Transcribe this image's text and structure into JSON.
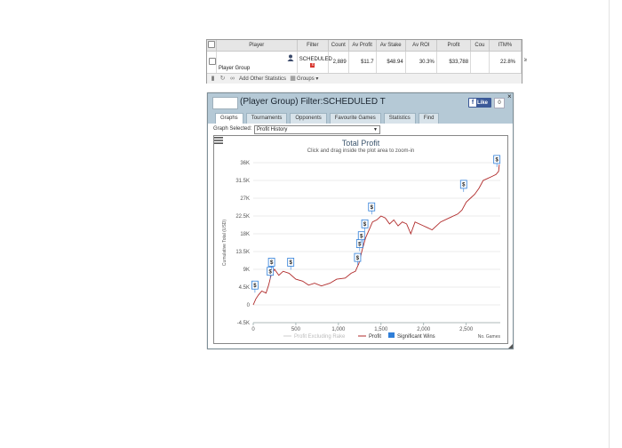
{
  "stats_table": {
    "headers": [
      "",
      "Player",
      "Filter",
      "Count",
      "Av Profit",
      "Av Stake",
      "Av ROI",
      "Profit",
      "Cou",
      "ITM%"
    ],
    "row": {
      "player": "Player Group",
      "filter": "SCHEDULED",
      "filter_badge": "x",
      "count": "2,889",
      "av_profit": "$11.7",
      "av_stake": "$48.94",
      "av_roi": "30.3%",
      "profit": "$33,788",
      "cou": "",
      "itm": "22.8%",
      "overflow": "≥"
    },
    "footer": {
      "add_stats": "Add Other Statistics",
      "groups": "Groups ▾"
    }
  },
  "window": {
    "title": "(Player Group) Filter:SCHEDULED T",
    "fb_like": "Like",
    "fb_count": "0",
    "close": "×",
    "tabs": [
      "Graphs",
      "Tournaments",
      "Opponents",
      "Favourite Games",
      "Statistics",
      "Find"
    ],
    "active_tab": "Graphs",
    "graph_selected_label": "Graph Selected:",
    "graph_selected_value": "Profit History"
  },
  "chart_data": {
    "type": "line",
    "title": "Total Profit",
    "subtitle": "Click and drag inside the plot area to zoom-in",
    "xlabel": "No. Games",
    "ylabel": "Cumulative Total (USD)",
    "xlim": [
      0,
      2900
    ],
    "ylim": [
      -4500,
      36000
    ],
    "x_ticks": [
      "0",
      "500",
      "1,000",
      "1,500",
      "2,000",
      "2,500"
    ],
    "y_ticks": [
      "-4.5K",
      "0",
      "4.5K",
      "9K",
      "13.5K",
      "18K",
      "22.5K",
      "27K",
      "31.5K",
      "36K"
    ],
    "legend": [
      {
        "name": "Profit Excluding Rake",
        "color": "#cccccc"
      },
      {
        "name": "Profit",
        "color": "#b02a2a"
      },
      {
        "name": "Significant Wins",
        "color": "#2f7ed8"
      }
    ],
    "series": [
      {
        "name": "Profit",
        "color": "#b02a2a",
        "x": [
          0,
          30,
          60,
          100,
          150,
          180,
          210,
          250,
          300,
          350,
          420,
          500,
          580,
          650,
          720,
          800,
          900,
          980,
          1080,
          1150,
          1200,
          1240,
          1280,
          1320,
          1360,
          1400,
          1450,
          1500,
          1550,
          1600,
          1650,
          1700,
          1750,
          1800,
          1850,
          1900,
          2000,
          2050,
          2100,
          2200,
          2300,
          2400,
          2450,
          2500,
          2550,
          2600,
          2650,
          2700,
          2750,
          2800,
          2850,
          2880,
          2889
        ],
        "y": [
          0,
          1500,
          2500,
          3500,
          3000,
          5000,
          7500,
          9000,
          7500,
          8500,
          8000,
          6500,
          6000,
          5000,
          5500,
          4800,
          5500,
          6500,
          6800,
          8000,
          8500,
          10500,
          14000,
          17000,
          19000,
          21000,
          21500,
          22500,
          22000,
          20500,
          21500,
          20000,
          21000,
          20500,
          18000,
          21000,
          20000,
          19500,
          19000,
          21000,
          22000,
          23000,
          24000,
          26000,
          27000,
          28000,
          29500,
          31500,
          32000,
          32500,
          33000,
          33788,
          35500
        ]
      }
    ],
    "significant_wins": [
      {
        "x": 20,
        "y": 4000
      },
      {
        "x": 200,
        "y": 7500
      },
      {
        "x": 215,
        "y": 9800
      },
      {
        "x": 440,
        "y": 9800
      },
      {
        "x": 1225,
        "y": 11000
      },
      {
        "x": 1250,
        "y": 14500
      },
      {
        "x": 1270,
        "y": 16500
      },
      {
        "x": 1310,
        "y": 19500
      },
      {
        "x": 1390,
        "y": 23800
      },
      {
        "x": 2470,
        "y": 29500
      },
      {
        "x": 2860,
        "y": 35800
      }
    ],
    "significant_win_label": "$"
  }
}
